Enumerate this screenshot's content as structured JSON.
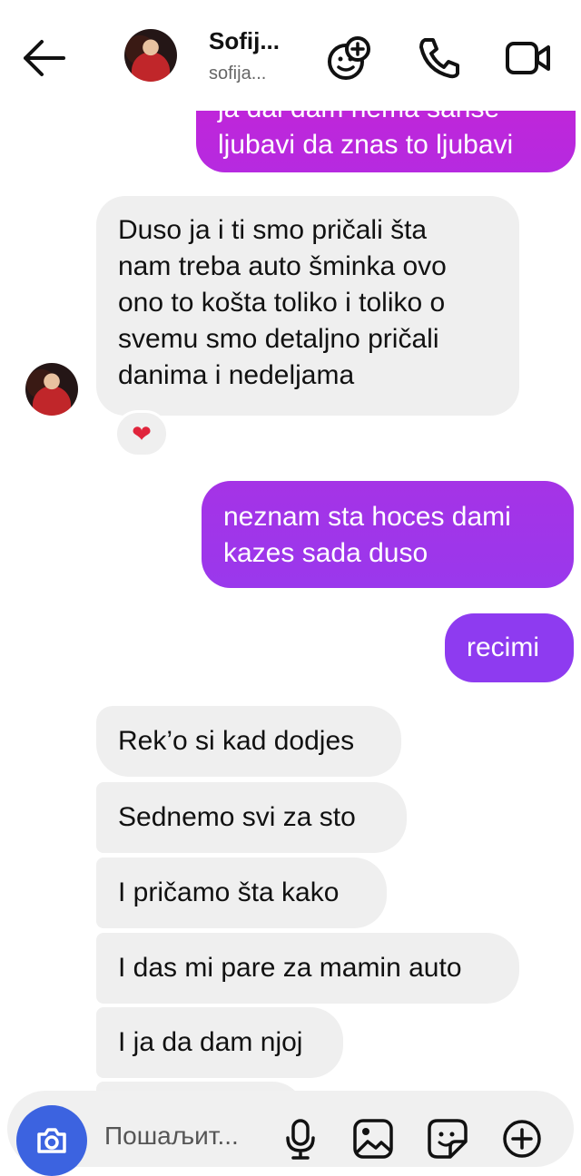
{
  "header": {
    "name": "Sofij...",
    "username": "sofija...",
    "icons": {
      "back": "arrow-left-icon",
      "effects": "avatar-add-icon",
      "call": "phone-icon",
      "video": "video-camera-icon"
    }
  },
  "messages": {
    "m1": {
      "lines": [
        "ja dal dam nema sanse",
        "ljubavi da znas to ljubavi"
      ]
    },
    "m2": {
      "lines": [
        "Duso ja i ti smo pričali šta",
        "nam treba auto šminka ovo",
        "ono to košta toliko i toliko o",
        "svemu smo detaljno pričali",
        "danima i nedeljama"
      ],
      "reaction": "❤"
    },
    "m3": {
      "lines": [
        "neznam sta hoces dami",
        "kazes sada duso"
      ]
    },
    "m4": {
      "lines": [
        "recimi"
      ]
    },
    "m5": {
      "lines": [
        "Rek’o si kad dodjes"
      ]
    },
    "m6": {
      "lines": [
        "Sednemo svi za sto"
      ]
    },
    "m7": {
      "lines": [
        "I pričamo šta kako"
      ]
    },
    "m8": {
      "lines": [
        "I das mi pare za mamin auto"
      ]
    },
    "m9": {
      "lines": [
        "I ja da dam njoj"
      ]
    }
  },
  "composer": {
    "placeholder": "Пошаљит...",
    "icons": {
      "camera": "camera-icon",
      "mic": "microphone-icon",
      "gallery": "image-icon",
      "sticker": "sticker-icon",
      "more": "plus-circle-icon"
    }
  },
  "colors": {
    "sent_top": "#c324d6",
    "sent_bottom": "#8e3bf0",
    "received_bg": "#efefef",
    "camera_button": "#3c63e0",
    "reaction": "#e0243b"
  }
}
